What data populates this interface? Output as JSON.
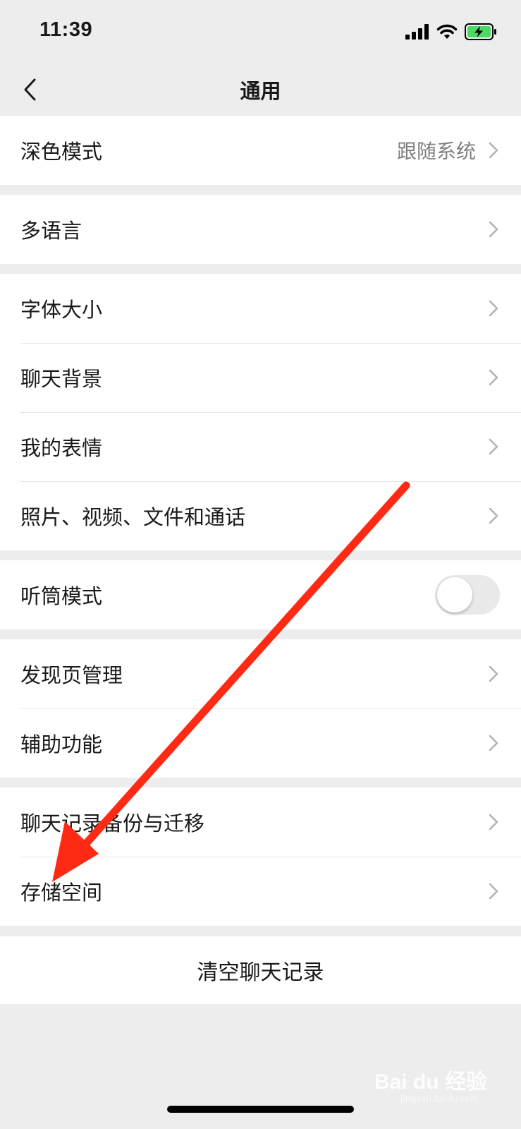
{
  "status_bar": {
    "time": "11:39"
  },
  "nav": {
    "title": "通用"
  },
  "groups": [
    {
      "rows": [
        {
          "label": "深色模式",
          "value": "跟随系统"
        }
      ]
    },
    {
      "rows": [
        {
          "label": "多语言"
        }
      ]
    },
    {
      "rows": [
        {
          "label": "字体大小"
        },
        {
          "label": "聊天背景"
        },
        {
          "label": "我的表情"
        },
        {
          "label": "照片、视频、文件和通话"
        }
      ]
    },
    {
      "rows": [
        {
          "label": "听筒模式",
          "toggle": false
        }
      ]
    },
    {
      "rows": [
        {
          "label": "发现页管理"
        },
        {
          "label": "辅助功能"
        }
      ]
    },
    {
      "rows": [
        {
          "label": "聊天记录备份与迁移"
        },
        {
          "label": "存储空间"
        }
      ]
    }
  ],
  "clear_button": {
    "label": "清空聊天记录"
  },
  "annotation": {
    "color": "#ff2a14",
    "points_to": "存储空间"
  },
  "watermark": {
    "text": "Bai du 经验",
    "sub": "jingyan.baidu.com"
  }
}
